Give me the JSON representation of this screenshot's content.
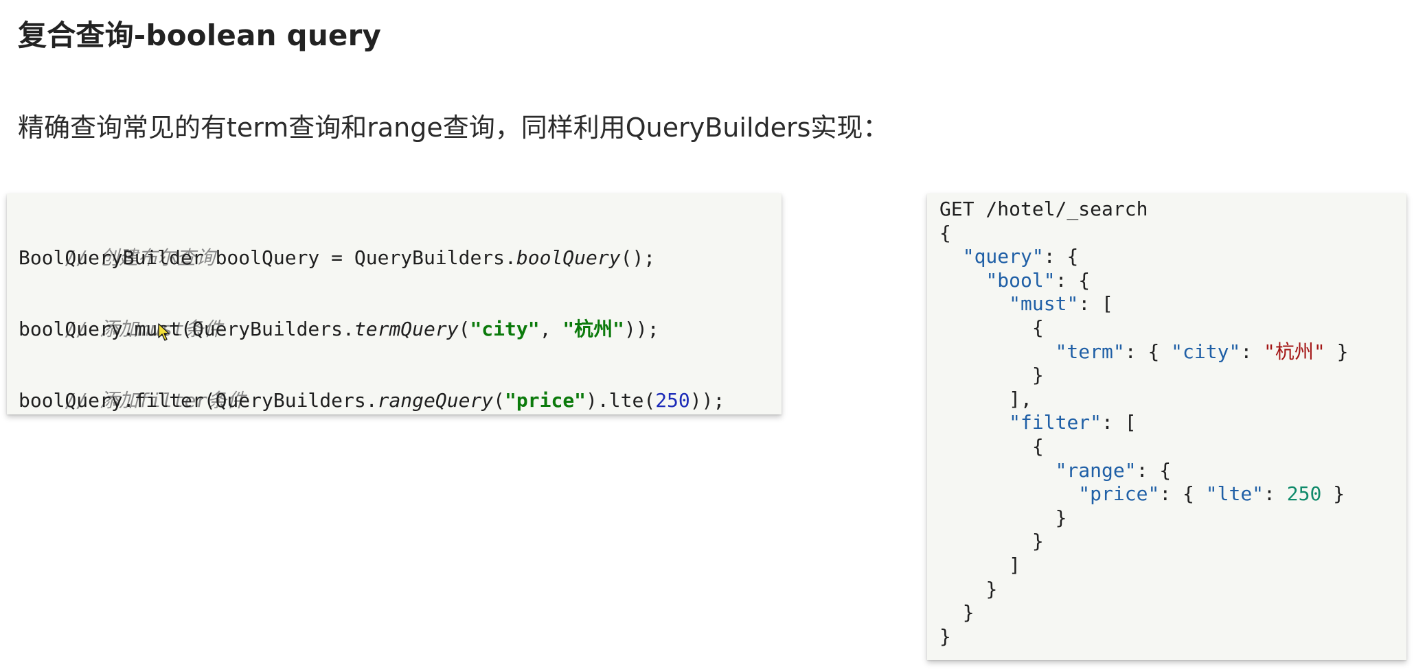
{
  "header": {
    "title": "复合查询-boolean query"
  },
  "intro": {
    "text": "精确查询常见的有term查询和range查询，同样利用QueryBuilders实现："
  },
  "java_code": {
    "comment_1": "// 创建布尔查询",
    "line_1": {
      "prefix": "BoolQueryBuilder boolQuery = QueryBuilders.",
      "method": "boolQuery",
      "suffix": "();"
    },
    "comment_2": "// 添加must条件",
    "line_2": {
      "prefix": "boolQuery.must(QueryBuilders.",
      "method": "termQuery",
      "open": "(",
      "arg1": "\"city\"",
      "sep": ", ",
      "arg2": "\"杭州\"",
      "close": "));"
    },
    "comment_3": "// 添加filter条件",
    "line_3": {
      "prefix": "boolQuery.filter(QueryBuilders.",
      "method": "rangeQuery",
      "open": "(",
      "arg1": "\"price\"",
      "mid": ").lte(",
      "num": "250",
      "close": "));"
    }
  },
  "dsl_code": {
    "request_line": "GET /hotel/_search",
    "lines": {
      "l1": "{",
      "l2_key": "\"query\"",
      "l2_rest": ": {",
      "l3_key": "\"bool\"",
      "l3_rest": ": {",
      "l4_key": "\"must\"",
      "l4_rest": ": [",
      "l5": "{",
      "l6_key": "\"term\"",
      "l6_mid": ": { ",
      "l6_key2": "\"city\"",
      "l6_colon": ": ",
      "l6_val": "\"杭州\"",
      "l6_end": " }",
      "l7": "}",
      "l8": "],",
      "l9_key": "\"filter\"",
      "l9_rest": ": [",
      "l10": "{",
      "l11_key": "\"range\"",
      "l11_rest": ": {",
      "l12_key": "\"price\"",
      "l12_mid": ": { ",
      "l12_key2": "\"lte\"",
      "l12_colon": ": ",
      "l12_val": "250",
      "l12_end": " }",
      "l13": "}",
      "l14": "}",
      "l15": "]",
      "l16": "}",
      "l17": "}",
      "l18": "}"
    }
  },
  "icons": {
    "cursor": "mouse-pointer-icon"
  },
  "colors": {
    "code_background": "#f6f7f3",
    "comment": "#8a8a8a",
    "string_bold": "#0b7a0b",
    "number": "#1c2bb8",
    "json_key": "#1f5fa6",
    "json_string_value": "#a31515",
    "json_number_value": "#0f8a6a"
  }
}
